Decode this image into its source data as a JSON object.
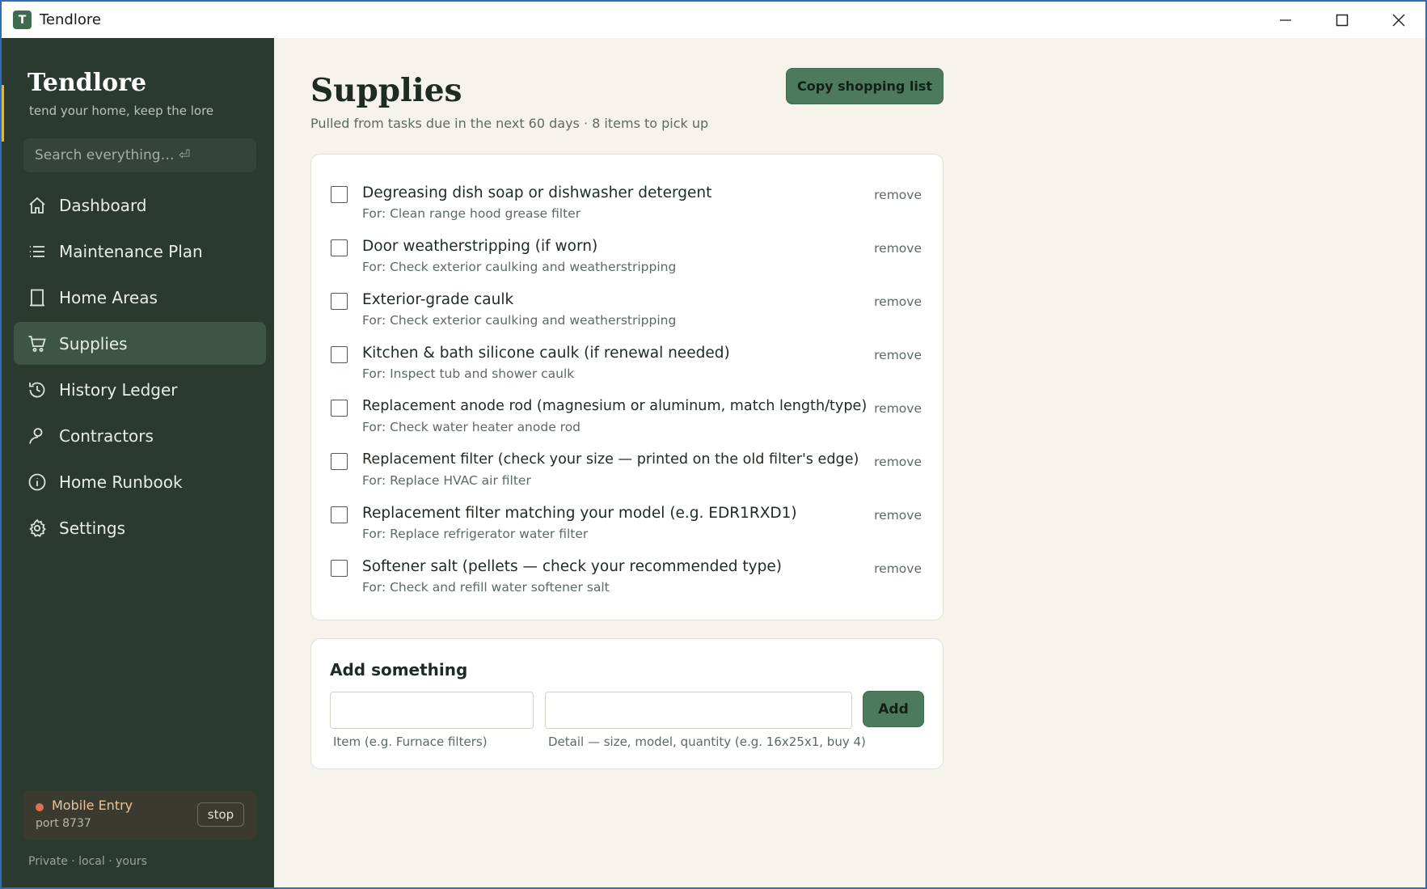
{
  "window": {
    "title": "Tendlore",
    "app_icon_letter": "T"
  },
  "sidebar": {
    "brand": "Tendlore",
    "tagline": "tend your home, keep the lore",
    "search_placeholder": "Search everything… ⏎",
    "items": [
      {
        "label": "Dashboard",
        "icon": "home-icon",
        "active": false
      },
      {
        "label": "Maintenance Plan",
        "icon": "list-icon",
        "active": false
      },
      {
        "label": "Home Areas",
        "icon": "door-icon",
        "active": false
      },
      {
        "label": "Supplies",
        "icon": "cart-icon",
        "active": true
      },
      {
        "label": "History Ledger",
        "icon": "history-icon",
        "active": false
      },
      {
        "label": "Contractors",
        "icon": "person-icon",
        "active": false
      },
      {
        "label": "Home Runbook",
        "icon": "info-icon",
        "active": false
      },
      {
        "label": "Settings",
        "icon": "gear-icon",
        "active": false
      }
    ],
    "mobile_entry": {
      "title": "Mobile Entry",
      "port": "port 8737",
      "stop_label": "stop",
      "status_color": "#e0704e"
    },
    "footer": "Private · local · yours"
  },
  "main": {
    "title": "Supplies",
    "subtitle": "Pulled from tasks due in the next 60 days · 8 items to pick up",
    "copy_button": "Copy shopping list",
    "remove_label": "remove",
    "items": [
      {
        "name": "Degreasing dish soap or dishwasher detergent",
        "for": "For: Clean range hood grease filter"
      },
      {
        "name": "Door weatherstripping (if worn)",
        "for": "For: Check exterior caulking and weatherstripping"
      },
      {
        "name": "Exterior-grade caulk",
        "for": "For: Check exterior caulking and weatherstripping"
      },
      {
        "name": "Kitchen & bath silicone caulk (if renewal needed)",
        "for": "For: Inspect tub and shower caulk"
      },
      {
        "name": "Replacement anode rod (magnesium or aluminum, match length/type)",
        "for": "For: Check water heater anode rod"
      },
      {
        "name": "Replacement filter (check your size — printed on the old filter's edge)",
        "for": "For: Replace HVAC air filter"
      },
      {
        "name": "Replacement filter matching your model (e.g. EDR1RXD1)",
        "for": "For: Replace refrigerator water filter"
      },
      {
        "name": "Softener salt (pellets — check your recommended type)",
        "for": "For: Check and refill water softener salt"
      }
    ],
    "add": {
      "title": "Add something",
      "item_value": "",
      "detail_value": "",
      "item_label": "Item (e.g. Furnace filters)",
      "detail_label": "Detail — size, model, quantity (e.g. 16x25x1, buy 4)",
      "add_button": "Add"
    }
  },
  "colors": {
    "sidebar_bg": "#2a3a2f",
    "accent": "#4d7a5c",
    "page_bg": "#f6f3ec"
  }
}
